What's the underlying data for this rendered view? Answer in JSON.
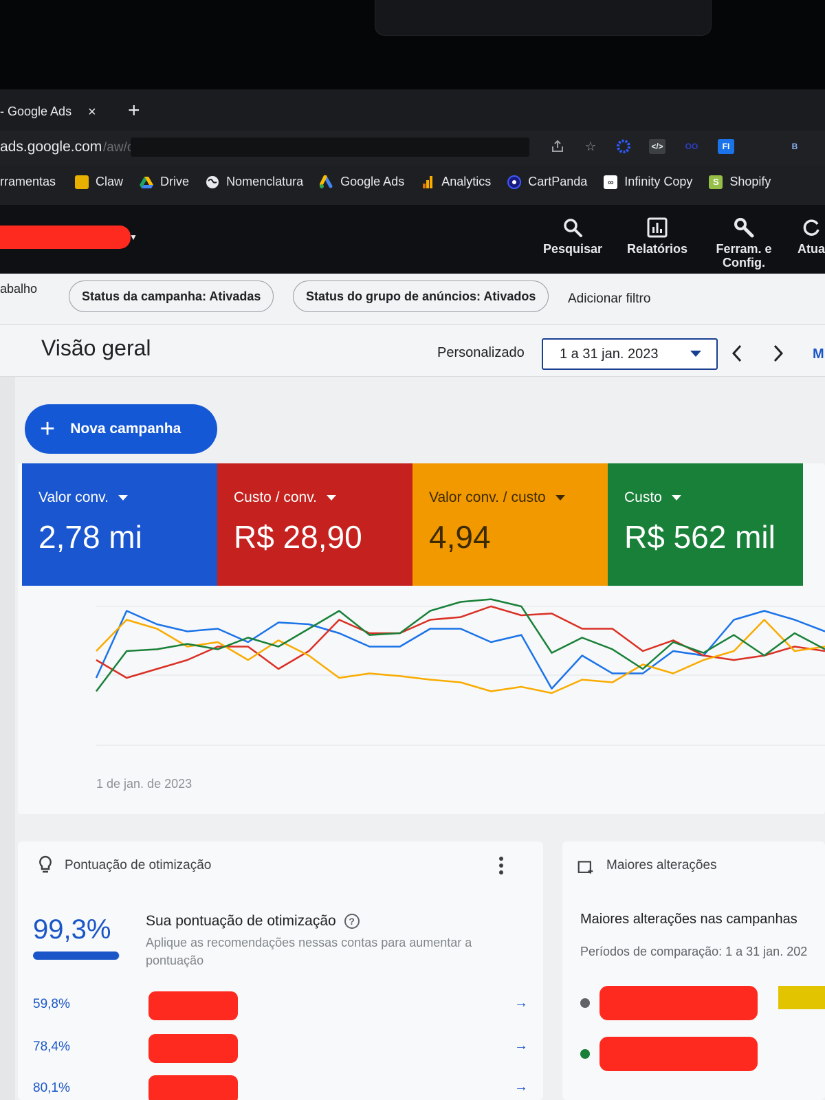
{
  "browser": {
    "tab_title": "- Google Ads",
    "tab_close": "×",
    "new_tab": "+",
    "url_host": "ads.google.com",
    "url_path": "/aw/ov",
    "bookmarks": [
      {
        "label": "rramentas",
        "icon": "none",
        "color": ""
      },
      {
        "label": "Claw",
        "icon": "folder-icon",
        "color": "#e8b100"
      },
      {
        "label": "Drive",
        "icon": "drive-icon",
        "color": "#1fa463"
      },
      {
        "label": "Nomenclatura",
        "icon": "globe-icon",
        "color": "#e8eaed"
      },
      {
        "label": "Google Ads",
        "icon": "google-ads-icon",
        "color": "#fbbc04"
      },
      {
        "label": "Analytics",
        "icon": "analytics-icon",
        "color": "#f9ab00"
      },
      {
        "label": "CartPanda",
        "icon": "cartpanda-icon",
        "color": "#3d5afe"
      },
      {
        "label": "Infinity Copy",
        "icon": "infinity-icon",
        "color": "#ffffff"
      },
      {
        "label": "Shopify",
        "icon": "shopify-icon",
        "color": "#95bf47"
      }
    ]
  },
  "header": {
    "buttons": [
      {
        "label": "Pesquisar",
        "icon": "search-icon"
      },
      {
        "label": "Relatórios",
        "icon": "reports-icon"
      },
      {
        "label": "Ferram. e Config.",
        "icon": "tools-icon"
      },
      {
        "label": "Atua",
        "icon": "refresh-icon"
      }
    ]
  },
  "filters": {
    "left_fragment": "abalho",
    "chips": [
      "Status da campanha: Ativadas",
      "Status do grupo de anúncios: Ativados"
    ],
    "add_filter": "Adicionar filtro"
  },
  "overview": {
    "title": "Visão geral",
    "preset": "Personalizado",
    "date_range": "1 a 31 jan. 2023",
    "prev": "‹",
    "next": "›",
    "more": "M"
  },
  "new_campaign": {
    "plus": "+",
    "label": "Nova campanha"
  },
  "scorecards": [
    {
      "label": "Valor conv.",
      "value": "2,78 mi",
      "color": "#1a56d0"
    },
    {
      "label": "Custo / conv.",
      "value": "R$ 28,90",
      "color": "#c5221f"
    },
    {
      "label": "Valor conv. / custo",
      "value": "4,94",
      "color": "#f29900"
    },
    {
      "label": "Custo",
      "value": "R$ 562 mil",
      "color": "#188038"
    }
  ],
  "chart_data": {
    "type": "line",
    "x_start_label": "1 de jan. de 2023",
    "y_axis_labels_visible": false,
    "grid": true,
    "series": [
      {
        "name": "Valor conv.",
        "color": "#1a73e8",
        "values": [
          0.2,
          0.95,
          0.8,
          0.72,
          0.75,
          0.6,
          0.82,
          0.8,
          0.7,
          0.55,
          0.55,
          0.75,
          0.75,
          0.6,
          0.68,
          0.08,
          0.45,
          0.25,
          0.25,
          0.5,
          0.45,
          0.85,
          0.95,
          0.85,
          0.72
        ]
      },
      {
        "name": "Custo / conv.",
        "color": "#d93025",
        "values": [
          0.4,
          0.2,
          0.3,
          0.4,
          0.55,
          0.55,
          0.3,
          0.5,
          0.85,
          0.7,
          0.7,
          0.85,
          0.88,
          1.0,
          0.9,
          0.92,
          0.75,
          0.75,
          0.5,
          0.62,
          0.45,
          0.4,
          0.45,
          0.55,
          0.5
        ]
      },
      {
        "name": "Valor conv. / custo",
        "color": "#f9ab00",
        "values": [
          0.5,
          0.85,
          0.75,
          0.55,
          0.6,
          0.4,
          0.62,
          0.45,
          0.2,
          0.25,
          0.22,
          0.18,
          0.15,
          0.05,
          0.1,
          0.03,
          0.18,
          0.15,
          0.35,
          0.25,
          0.4,
          0.5,
          0.85,
          0.5,
          0.55
        ]
      },
      {
        "name": "Custo",
        "color": "#188038",
        "values": [
          0.05,
          0.5,
          0.52,
          0.58,
          0.52,
          0.65,
          0.55,
          0.75,
          0.95,
          0.68,
          0.7,
          0.95,
          1.05,
          1.08,
          1.0,
          0.48,
          0.65,
          0.52,
          0.3,
          0.6,
          0.48,
          0.68,
          0.45,
          0.7,
          0.52
        ]
      }
    ]
  },
  "optimization": {
    "title": "Pontuação de otimização",
    "score": "99,3%",
    "score_fraction": 0.993,
    "heading": "Sua pontuação de otimização",
    "help": "?",
    "subtitle": "Aplique as recomendações nessas contas para aumentar a pontuação",
    "accounts": [
      {
        "pct": "59,8%",
        "arrow": "→"
      },
      {
        "pct": "78,4%",
        "arrow": "→"
      },
      {
        "pct": "80,1%",
        "arrow": "→"
      }
    ]
  },
  "changes": {
    "title": "Maiores alterações",
    "heading": "Maiores alterações nas campanhas",
    "subtitle": "Períodos de comparação: 1 a 31 jan. 202",
    "rows": [
      {
        "status_color": "#5f6368"
      },
      {
        "status_color": "#188038"
      }
    ]
  }
}
